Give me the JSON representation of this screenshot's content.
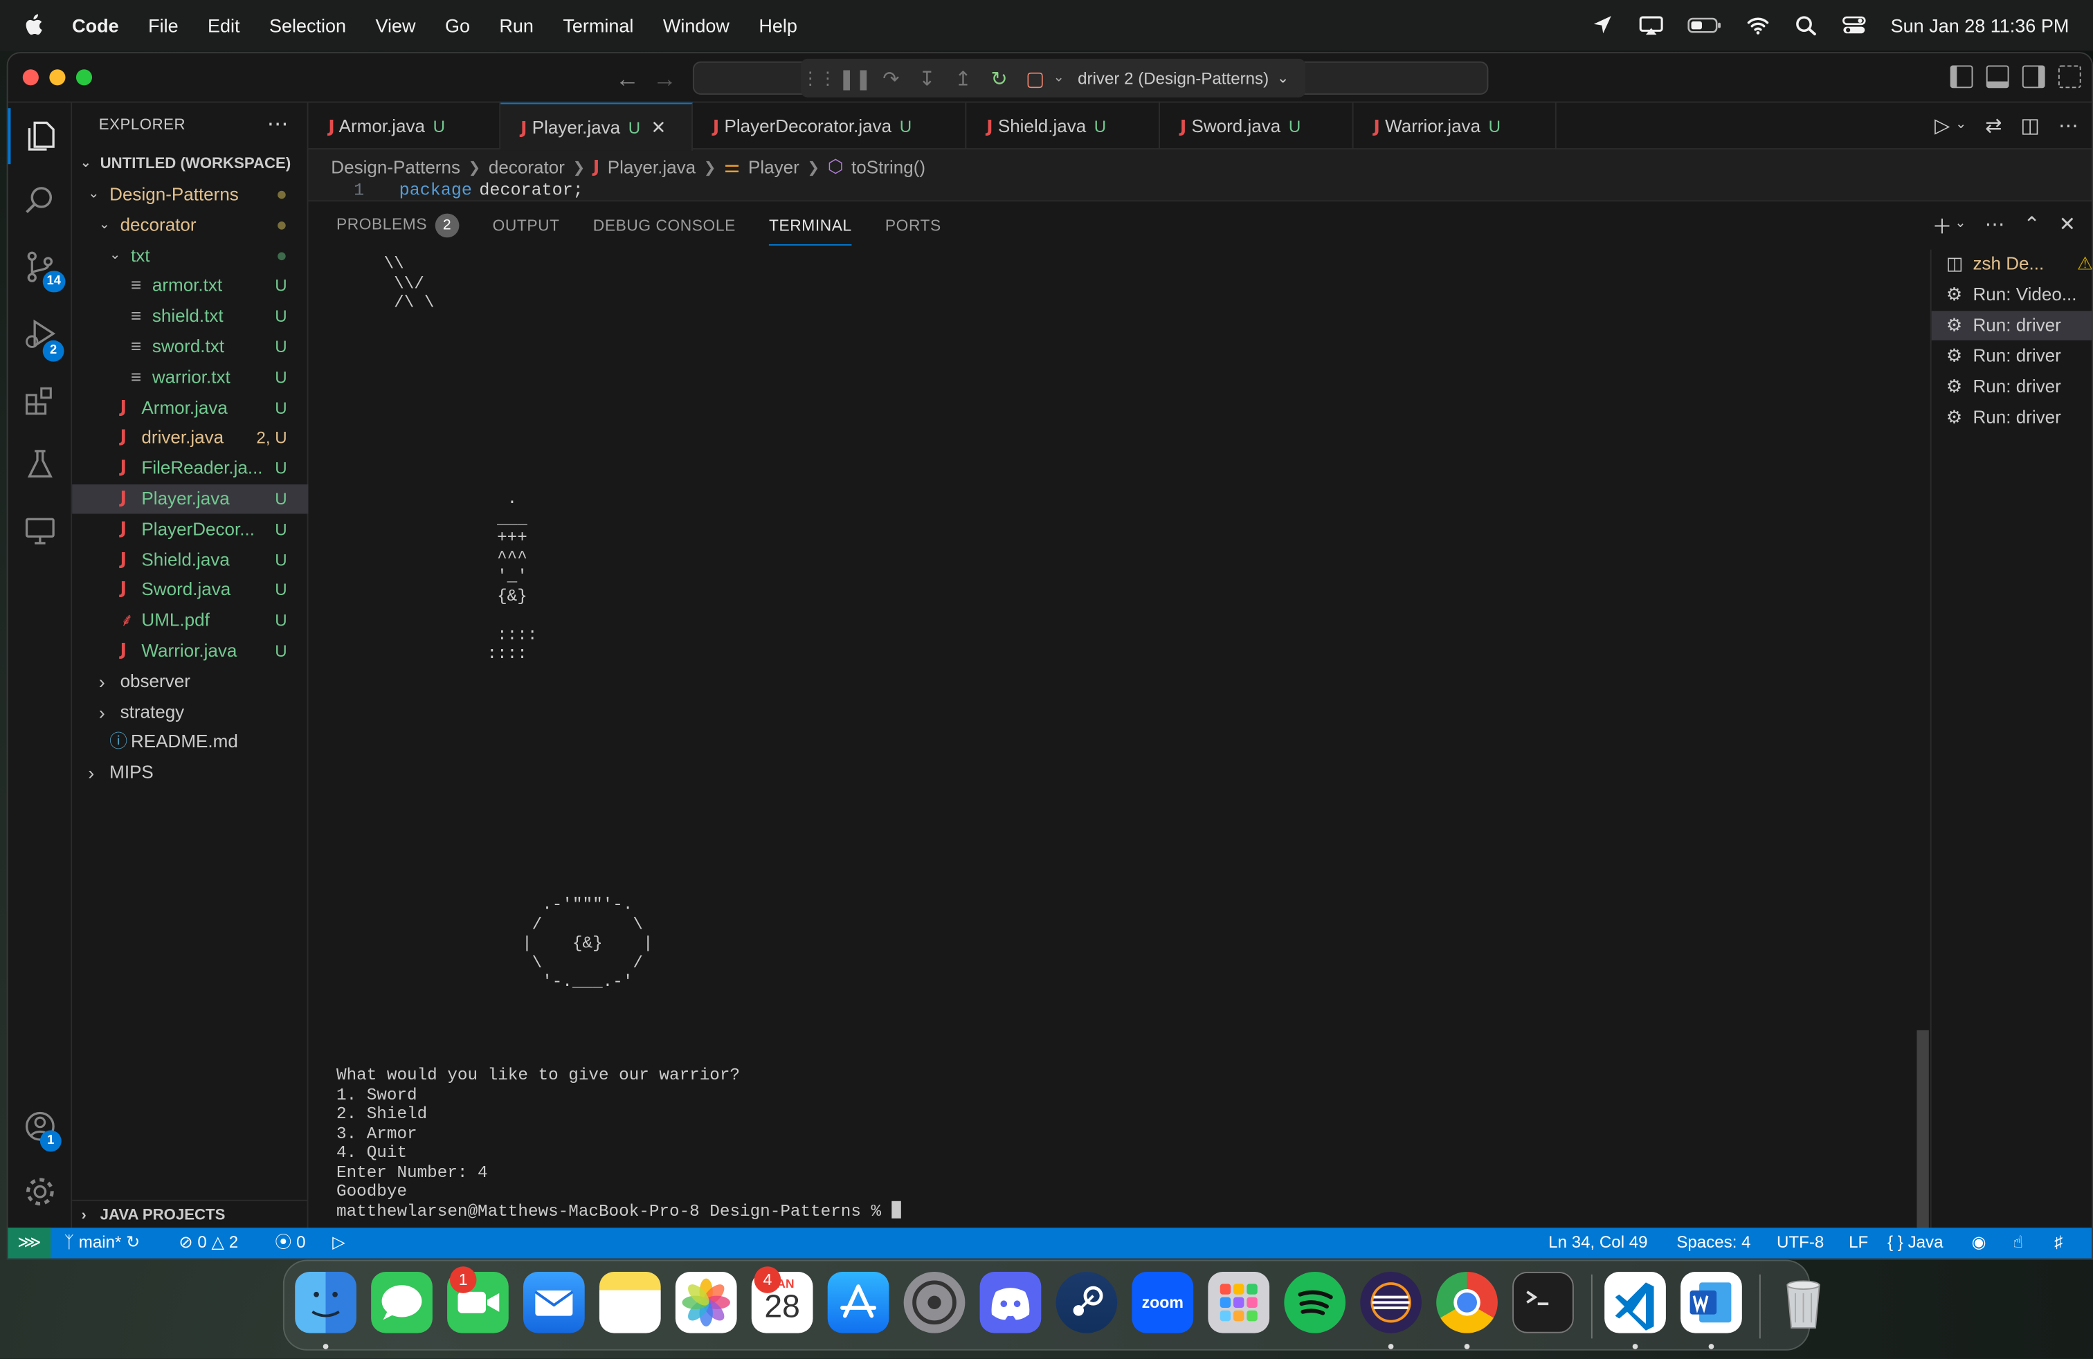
{
  "menubar": {
    "app": "Code",
    "items": [
      "File",
      "Edit",
      "Selection",
      "View",
      "Go",
      "Run",
      "Terminal",
      "Window",
      "Help"
    ],
    "clock": "Sun Jan 28  11:36 PM"
  },
  "titlebar": {
    "debug_config": "driver 2 (Design-Patterns)"
  },
  "activity": {
    "scm_badge": "14",
    "debug_badge": "2",
    "accounts_badge": "1"
  },
  "explorer": {
    "header": "EXPLORER",
    "workspace": "UNTITLED (WORKSPACE)",
    "rows": [
      {
        "label": "Design-Patterns",
        "status": "",
        "color": "yellow",
        "indent": 0,
        "chev": "v",
        "dot": true
      },
      {
        "label": "decorator",
        "status": "",
        "color": "yellow",
        "indent": 1,
        "chev": "v",
        "dot": true
      },
      {
        "label": "txt",
        "status": "",
        "color": "green",
        "indent": 2,
        "chev": "v",
        "dot": true,
        "dotcolor": "green"
      },
      {
        "label": "armor.txt",
        "status": "U",
        "color": "green",
        "indent": 3,
        "icon": "txt"
      },
      {
        "label": "shield.txt",
        "status": "U",
        "color": "green",
        "indent": 3,
        "icon": "txt"
      },
      {
        "label": "sword.txt",
        "status": "U",
        "color": "green",
        "indent": 3,
        "icon": "txt"
      },
      {
        "label": "warrior.txt",
        "status": "U",
        "color": "green",
        "indent": 3,
        "icon": "txt"
      },
      {
        "label": "Armor.java",
        "status": "U",
        "color": "green",
        "indent": 2,
        "icon": "java"
      },
      {
        "label": "driver.java",
        "status": "2, U",
        "color": "yellow",
        "indent": 2,
        "icon": "java"
      },
      {
        "label": "FileReader.ja...",
        "status": "U",
        "color": "green",
        "indent": 2,
        "icon": "java"
      },
      {
        "label": "Player.java",
        "status": "U",
        "color": "green",
        "indent": 2,
        "icon": "java",
        "selected": true
      },
      {
        "label": "PlayerDecor...",
        "status": "U",
        "color": "green",
        "indent": 2,
        "icon": "java"
      },
      {
        "label": "Shield.java",
        "status": "U",
        "color": "green",
        "indent": 2,
        "icon": "java"
      },
      {
        "label": "Sword.java",
        "status": "U",
        "color": "green",
        "indent": 2,
        "icon": "java"
      },
      {
        "label": "UML.pdf",
        "status": "U",
        "color": "green",
        "indent": 2,
        "icon": "pdf"
      },
      {
        "label": "Warrior.java",
        "status": "U",
        "color": "green",
        "indent": 2,
        "icon": "java"
      },
      {
        "label": "observer",
        "status": "",
        "color": "white",
        "indent": 1,
        "chev": ">"
      },
      {
        "label": "strategy",
        "status": "",
        "color": "white",
        "indent": 1,
        "chev": ">"
      },
      {
        "label": "README.md",
        "status": "",
        "color": "white",
        "indent": 1,
        "icon": "info"
      },
      {
        "label": "MIPS",
        "status": "",
        "color": "white",
        "indent": 0,
        "chev": ">"
      }
    ],
    "java_projects": "JAVA PROJECTS"
  },
  "tabs": [
    {
      "label": "Armor.java",
      "status": "U",
      "active": false
    },
    {
      "label": "Player.java",
      "status": "U",
      "active": true
    },
    {
      "label": "PlayerDecorator.java",
      "status": "U",
      "active": false
    },
    {
      "label": "Shield.java",
      "status": "U",
      "active": false
    },
    {
      "label": "Sword.java",
      "status": "U",
      "active": false
    },
    {
      "label": "Warrior.java",
      "status": "U",
      "active": false
    }
  ],
  "breadcrumb": [
    "Design-Patterns",
    "decorator",
    "Player.java",
    "Player",
    "toString()"
  ],
  "code": {
    "line_no": "1",
    "keyword": "package",
    "name": "decorator;"
  },
  "panel": {
    "tabs": [
      "PROBLEMS",
      "OUTPUT",
      "DEBUG CONSOLE",
      "TERMINAL",
      "PORTS"
    ],
    "problems_count": "2",
    "active_tab": "TERMINAL"
  },
  "terminal": {
    "art_sword": " \\\\\n  \\\\/\n  /\\ \\",
    "art_warrior": "       .\n      ___\n      +++\n      ^^^\n      '_'\n      {&}\n\n      ::::\n     ::::",
    "art_shield": "  .-'\"\"\"'-.\n /         \\\n|    {&}    |\n \\         /\n  '-.___.-'",
    "prompt_lines": "What would you like to give our warrior?\n1. Sword\n2. Shield\n3. Armor\n4. Quit\nEnter Number: 4\nGoodbye",
    "shell_prompt": "matthewlarsen@Matthews-MacBook-Pro-8 Design-Patterns % ",
    "instances": [
      "zsh De...",
      "Run: Video...",
      "Run: driver",
      "Run: driver",
      "Run: driver",
      "Run: driver"
    ]
  },
  "statusbar": {
    "branch": "main*",
    "errors": "0",
    "warnings": "2",
    "ports": "0",
    "position": "Ln 34, Col 49",
    "spaces": "Spaces: 4",
    "encoding": "UTF-8",
    "eol": "LF",
    "language": "Java"
  },
  "dock": {
    "facetime_badge": "1",
    "calendar_month": "JAN",
    "calendar_day": "28",
    "calendar_badge": "4",
    "zoom_label": "zoom"
  },
  "colors": {
    "accent": "#0078d4",
    "untracked": "#73c991",
    "modified": "#e2c08d",
    "java_icon": "#e34d4d",
    "status_remote": "#16825d"
  }
}
